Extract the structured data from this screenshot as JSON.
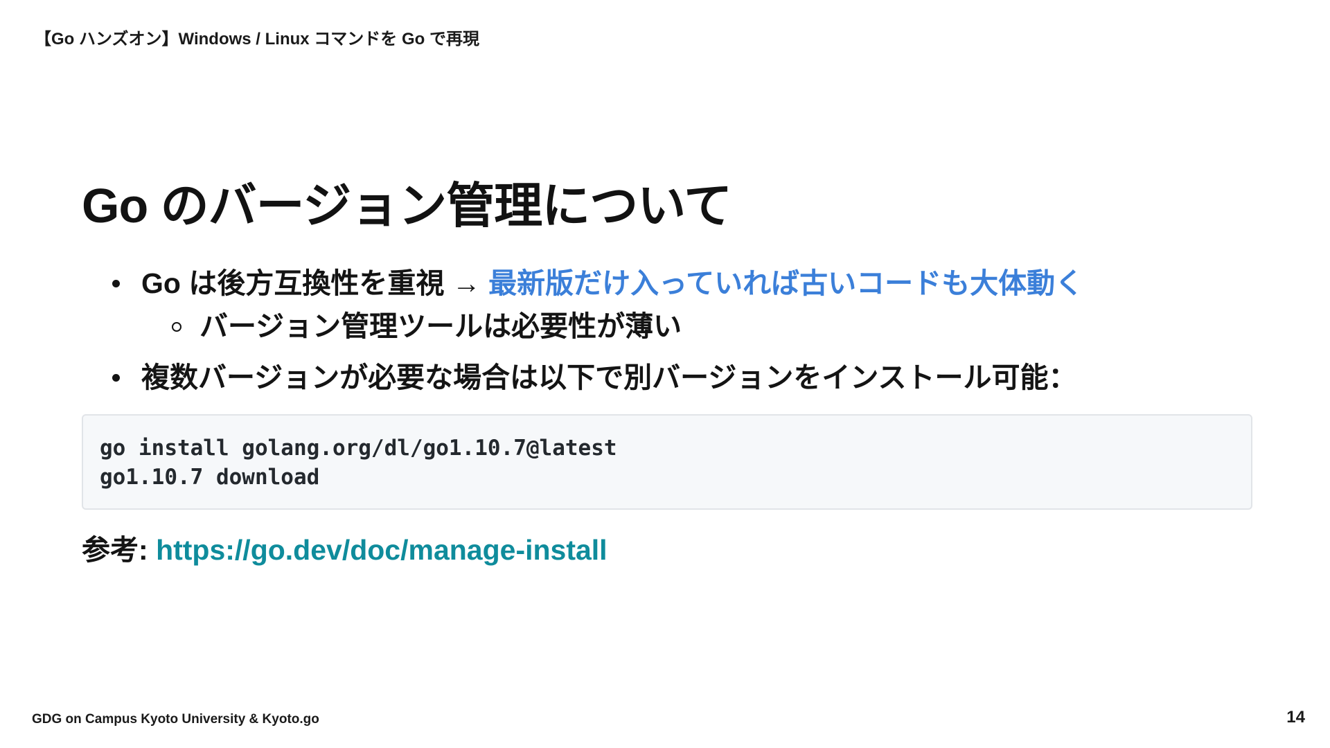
{
  "header": {
    "title": "【Go ハンズオン】Windows / Linux コマンドを Go で再現"
  },
  "slide": {
    "title": "Go のバージョン管理について",
    "bullets": [
      {
        "text": "Go は後方互換性を重視",
        "arrow": "→",
        "highlight": "最新版だけ入っていれば古いコードも大体動く",
        "sub": [
          "バージョン管理ツールは必要性が薄い"
        ]
      },
      {
        "text": "複数バージョンが必要な場合は以下で別バージョンをインストール可能："
      }
    ],
    "code": {
      "lines": [
        "go install golang.org/dl/go1.10.7@latest",
        "go1.10.7 download"
      ]
    },
    "reference": {
      "label": "参考:",
      "link_text": "https://go.dev/doc/manage-install"
    }
  },
  "footer": {
    "text": "GDG on Campus Kyoto University & Kyoto.go",
    "page_number": "14"
  },
  "colors": {
    "highlight": "#3b7fd9",
    "link": "#0f8c9c",
    "code_background": "#f6f8fa",
    "code_border": "#e1e4e8"
  }
}
